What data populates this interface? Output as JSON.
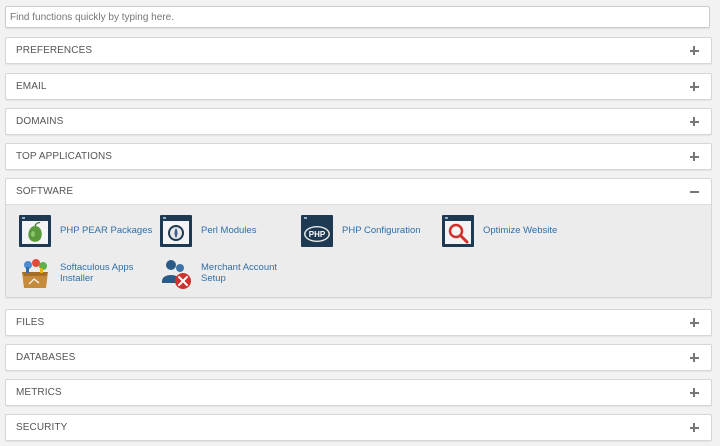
{
  "search": {
    "placeholder": "Find functions quickly by typing here."
  },
  "sections": {
    "preferences": "PREFERENCES",
    "email": "EMAIL",
    "domains": "DOMAINS",
    "top_applications": "TOP APPLICATIONS",
    "software": "SOFTWARE",
    "files": "FILES",
    "databases": "DATABASES",
    "metrics": "METRICS",
    "security": "SECURITY"
  },
  "software_items": {
    "php_pear": "PHP PEAR Packages",
    "perl_modules": "Perl Modules",
    "php_config": "PHP Configuration",
    "optimize_website": "Optimize Website",
    "softaculous_line1": "Softaculous Apps",
    "softaculous_line2": "Installer",
    "merchant_line1": "Merchant Account",
    "merchant_line2": "Setup"
  },
  "icons": {
    "php_logo_text": "PHP"
  },
  "colors": {
    "link": "#2f6fa7",
    "icon_dark": "#1d3a52",
    "accent_red": "#d0312d"
  }
}
